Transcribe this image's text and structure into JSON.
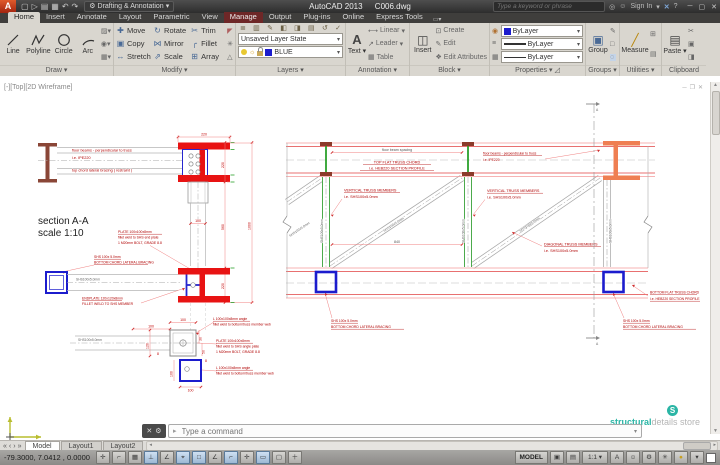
{
  "title_bar": {
    "app_name": "AutoCAD 2013",
    "doc_name": "C006.dwg",
    "workspace": "Drafting & Annotation",
    "search_placeholder": "Type a keyword or phrase",
    "sign_in": "Sign In"
  },
  "ribbon": {
    "tabs": [
      {
        "label": "Home"
      },
      {
        "label": "Insert"
      },
      {
        "label": "Annotate"
      },
      {
        "label": "Layout"
      },
      {
        "label": "Parametric"
      },
      {
        "label": "View"
      },
      {
        "label": "Manage"
      },
      {
        "label": "Output"
      },
      {
        "label": "Plug-ins"
      },
      {
        "label": "Online"
      },
      {
        "label": "Express Tools"
      }
    ]
  },
  "panels": {
    "draw": {
      "title": "Draw",
      "buttons": [
        "Line",
        "Polyline",
        "Circle",
        "Arc"
      ]
    },
    "modify": {
      "title": "Modify",
      "buttons": [
        "Move",
        "Rotate",
        "Trim",
        "Copy",
        "Mirror",
        "Fillet",
        "Stretch",
        "Scale",
        "Array"
      ]
    },
    "layers": {
      "title": "Layers",
      "layer_state": "Unsaved Layer State",
      "current_layer": "BLUE"
    },
    "annotation": {
      "title": "Annotation",
      "text_label": "Text",
      "buttons": [
        "Linear",
        "Leader",
        "Table"
      ]
    },
    "block": {
      "title": "Block",
      "insert_label": "Insert",
      "buttons": [
        "Create",
        "Edit",
        "Edit Attributes"
      ]
    },
    "properties": {
      "title": "Properties",
      "rows": [
        "ByLayer",
        "ByLayer",
        "ByLayer"
      ]
    },
    "groups": {
      "title": "Groups",
      "group_label": "Group"
    },
    "utilities": {
      "title": "Utilities",
      "measure_label": "Measure"
    },
    "clipboard": {
      "title": "Clipboard",
      "paste_label": "Paste"
    }
  },
  "canvas": {
    "viewport_label": "[-][Top][2D Wireframe]"
  },
  "drawing": {
    "section_title": "section A-A",
    "section_scale": "scale 1:10",
    "floor_beams_1": "floor beams - perpendicular to truss",
    "floor_beams_2": "i.e. IPE220",
    "top_bracing": "top chord lateral bracing ( restraint )",
    "plate_1": "PLATE 100x100x8mm",
    "plate_2": "fillet weld to SHS end plate",
    "bolt": "1 M20mm BOLT, GRADE 8.8",
    "shs_size": "SHS 100x 5.0mm",
    "bottom_bracing": "BOTTOM CHORD LATERAL BRACING",
    "shs_tag": "SHS100x5.0mm",
    "endplate_1": "ENDPLATE 120x120x8mm",
    "endplate_2": "FILLET WELD TO SHS MEMBER",
    "angle_1": "L 100x100x8mm angle",
    "angle_2": "fillet weld to bottom/truss member web",
    "plate_weld_angle": "fillet weld to SHS angle plate",
    "beam_spacing": "floor beam spacing",
    "top_chord_1": "TOP FLAT TRUSS CHORD",
    "top_chord_2": "i.e. HEB220 SECTION PROFILE",
    "vert_1": "VERTICAL TRUSS MEMBERS",
    "vert_2": "i.e. SHS100x5.0mm",
    "diag_1": "DIAGONAL TRUSS MEMBERS",
    "diag_2": "i.e. SHS100x5.0mm",
    "bot_chord_1": "BOTTOM FLAT TRUSS CHORD",
    "bot_chord_2": "i.e. HEB220 SECTION PROFILE",
    "marker_a": "A",
    "dims": {
      "d220": "220",
      "d100": "100",
      "d560": "560",
      "d1000": "1000",
      "d120": "120",
      "d840": "840",
      "d8": "8",
      "d30": "30",
      "d50": "50"
    }
  },
  "command_line": {
    "placeholder": "Type a command"
  },
  "layout_tabs": [
    {
      "label": "Model"
    },
    {
      "label": "Layout1"
    },
    {
      "label": "Layout2"
    }
  ],
  "status_bar": {
    "coords": "-79.3000, 7.0412 , 0.0000",
    "model_label": "MODEL",
    "annotation_scale": "1:1"
  },
  "branding": {
    "circle_letter": "S",
    "bold": "structural",
    "light": "details store"
  },
  "colors": {
    "accent_red": "#e81313",
    "dim_red": "#f08080",
    "shs_blue": "#1c1ccd",
    "web_green": "#2aa02a",
    "beam_orange": "#ef7f52",
    "beam_brown": "#8a4637"
  }
}
